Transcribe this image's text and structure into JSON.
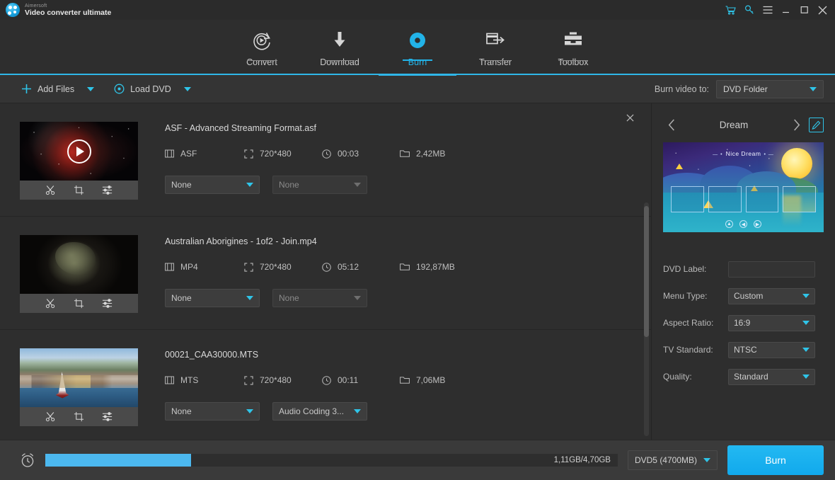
{
  "window": {
    "brand_sub": "Aimersoft",
    "brand_name": "Video converter ultimate",
    "controls": {
      "cart": "cart-icon",
      "key": "key-icon",
      "menu": "hamburger-menu-icon",
      "minimize": "minimize-icon",
      "maximize": "maximize-icon",
      "close": "close-icon"
    }
  },
  "nav": {
    "items": [
      {
        "label": "Convert",
        "icon": "convert-icon",
        "active": false
      },
      {
        "label": "Download",
        "icon": "download-icon",
        "active": false
      },
      {
        "label": "Burn",
        "icon": "burn-disc-icon",
        "active": true
      },
      {
        "label": "Transfer",
        "icon": "transfer-icon",
        "active": false
      },
      {
        "label": "Toolbox",
        "icon": "toolbox-icon",
        "active": false
      }
    ]
  },
  "toolbar": {
    "add_files_label": "Add Files",
    "add_files_icon": "plus-icon",
    "load_dvd_label": "Load DVD",
    "load_dvd_icon": "disc-icon",
    "burn_video_to_label": "Burn video to:",
    "burn_video_to_value": "DVD Folder"
  },
  "files": [
    {
      "name": "ASF - Advanced Streaming Format.asf",
      "format": "ASF",
      "resolution": "720*480",
      "duration": "00:03",
      "size": "2,42MB",
      "subtitle_select": "None",
      "audio_select": "None",
      "audio_enabled": false,
      "has_play_overlay": true,
      "art": "art-space"
    },
    {
      "name": "Australian Aborigines - 1of2 - Join.mp4",
      "format": "MP4",
      "resolution": "720*480",
      "duration": "05:12",
      "size": "192,87MB",
      "subtitle_select": "None",
      "audio_select": "None",
      "audio_enabled": false,
      "has_play_overlay": false,
      "art": "art-globe"
    },
    {
      "name": "00021_CAA30000.MTS",
      "format": "MTS",
      "resolution": "720*480",
      "duration": "00:11",
      "size": "7,06MB",
      "subtitle_select": "None",
      "audio_select": "Audio Coding 3...",
      "audio_enabled": true,
      "has_play_overlay": false,
      "art": "art-harbor"
    }
  ],
  "row_tools": {
    "trim": "scissors-icon",
    "crop": "crop-icon",
    "effect": "sliders-icon"
  },
  "panel": {
    "template_name": "Dream",
    "prev_icon": "chevron-left-icon",
    "next_icon": "chevron-right-icon",
    "edit_icon": "pencil-edit-icon",
    "preview": {
      "title": "Nice Dream",
      "left_dash": "— •",
      "right_dash": "• —",
      "nav_buttons": [
        "▲",
        "◀",
        "▶"
      ]
    },
    "settings": [
      {
        "label": "DVD Label:",
        "value": "",
        "type": "input"
      },
      {
        "label": "Menu Type:",
        "value": "Custom",
        "type": "select"
      },
      {
        "label": "Aspect Ratio:",
        "value": "16:9",
        "type": "select"
      },
      {
        "label": "TV Standard:",
        "value": "NTSC",
        "type": "select"
      },
      {
        "label": "Quality:",
        "value": "Standard",
        "type": "select"
      }
    ]
  },
  "bottom": {
    "clock_icon": "alarm-clock-icon",
    "progress_text": "1,11GB/4,70GB",
    "progress_percent": 25.5,
    "disc_type": "DVD5 (4700MB)",
    "burn_label": "Burn"
  },
  "colors": {
    "accent": "#2fc4e8",
    "active_tab": "#22b3e8",
    "progress": "#4cb8ef",
    "burn_button": "#11a9ec"
  }
}
